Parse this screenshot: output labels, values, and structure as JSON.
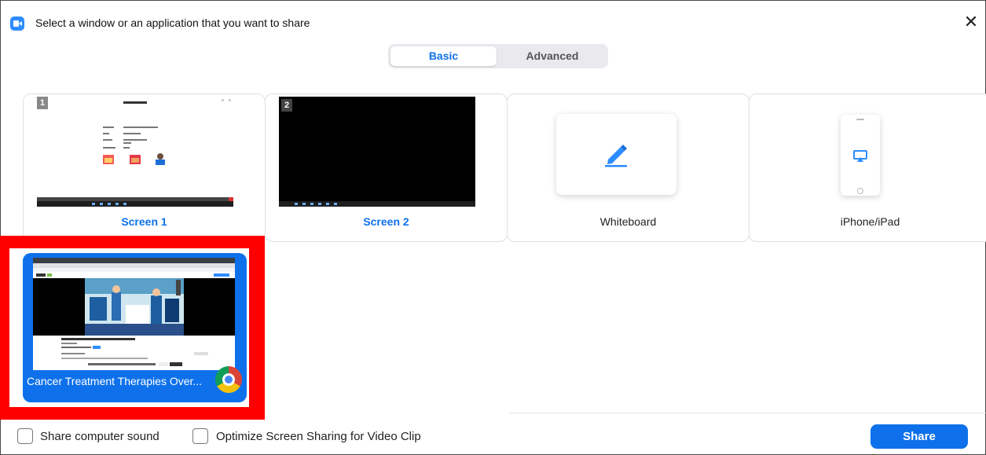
{
  "window": {
    "title": "Select a window or an application that you want to share",
    "close_symbol": "✕"
  },
  "tabs": [
    {
      "label": "Basic",
      "selected": true
    },
    {
      "label": "Advanced",
      "selected": false
    }
  ],
  "share_options": [
    {
      "label": "Screen 1",
      "badge": "1",
      "icon": "screen-thumbnail"
    },
    {
      "label": "Screen 2",
      "badge": "2",
      "icon": "screen-thumbnail"
    },
    {
      "label": "Whiteboard",
      "icon": "pen-icon"
    },
    {
      "label": "iPhone/iPad",
      "icon": "airplay-icon"
    }
  ],
  "windows": [
    {
      "label": "Cancer Treatment Therapies Over...",
      "app_icon": "chrome-icon",
      "selected": true
    }
  ],
  "footer": {
    "share_sound_label": "Share computer sound",
    "share_sound_checked": false,
    "optimize_label": "Optimize Screen Sharing for Video Clip",
    "optimize_checked": false,
    "share_button": "Share"
  },
  "colors": {
    "accent": "#0E71EB",
    "highlight": "#FF0000"
  }
}
